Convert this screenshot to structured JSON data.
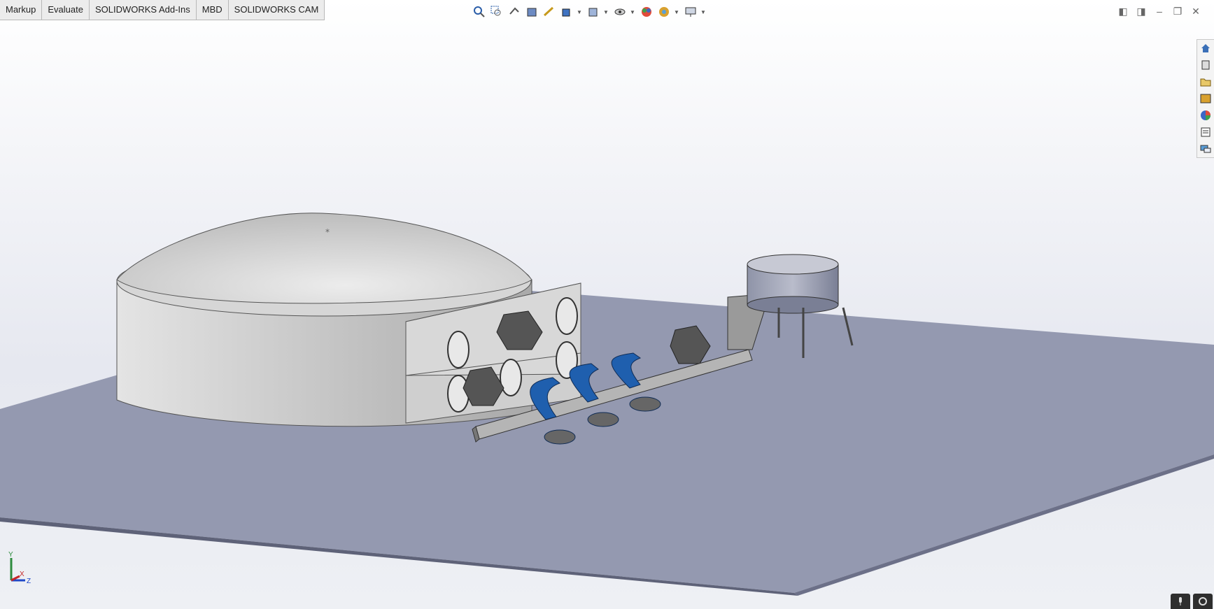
{
  "tabs": [
    "Markup",
    "Evaluate",
    "SOLIDWORKS Add-Ins",
    "MBD",
    "SOLIDWORKS CAM"
  ],
  "heads_up_toolbar": {
    "icons": [
      "zoom-to-fit-icon",
      "zoom-to-area-icon",
      "previous-view-icon",
      "section-view-icon",
      "dynamic-annotation-view-icon",
      "view-orientation-icon",
      "display-style-icon",
      "hide-show-items-icon",
      "edit-appearance-icon",
      "apply-scene-icon",
      "view-settings-icon"
    ]
  },
  "window_controls": [
    "tile-left-icon",
    "tile-right-icon",
    "minimize-icon",
    "restore-icon",
    "close-icon"
  ],
  "task_pane": [
    "solidworks-resources-icon",
    "design-library-icon",
    "file-explorer-icon",
    "view-palette-icon",
    "appearances-scenes-icon",
    "custom-properties-icon",
    "forum-icon"
  ],
  "triad": {
    "x": "X",
    "y": "Y",
    "z": "Z"
  },
  "colors": {
    "floor": "#9499b0",
    "dome": "#d7d7d7",
    "robot_blue": "#1f5fae",
    "rail": "#8a8a8a"
  }
}
